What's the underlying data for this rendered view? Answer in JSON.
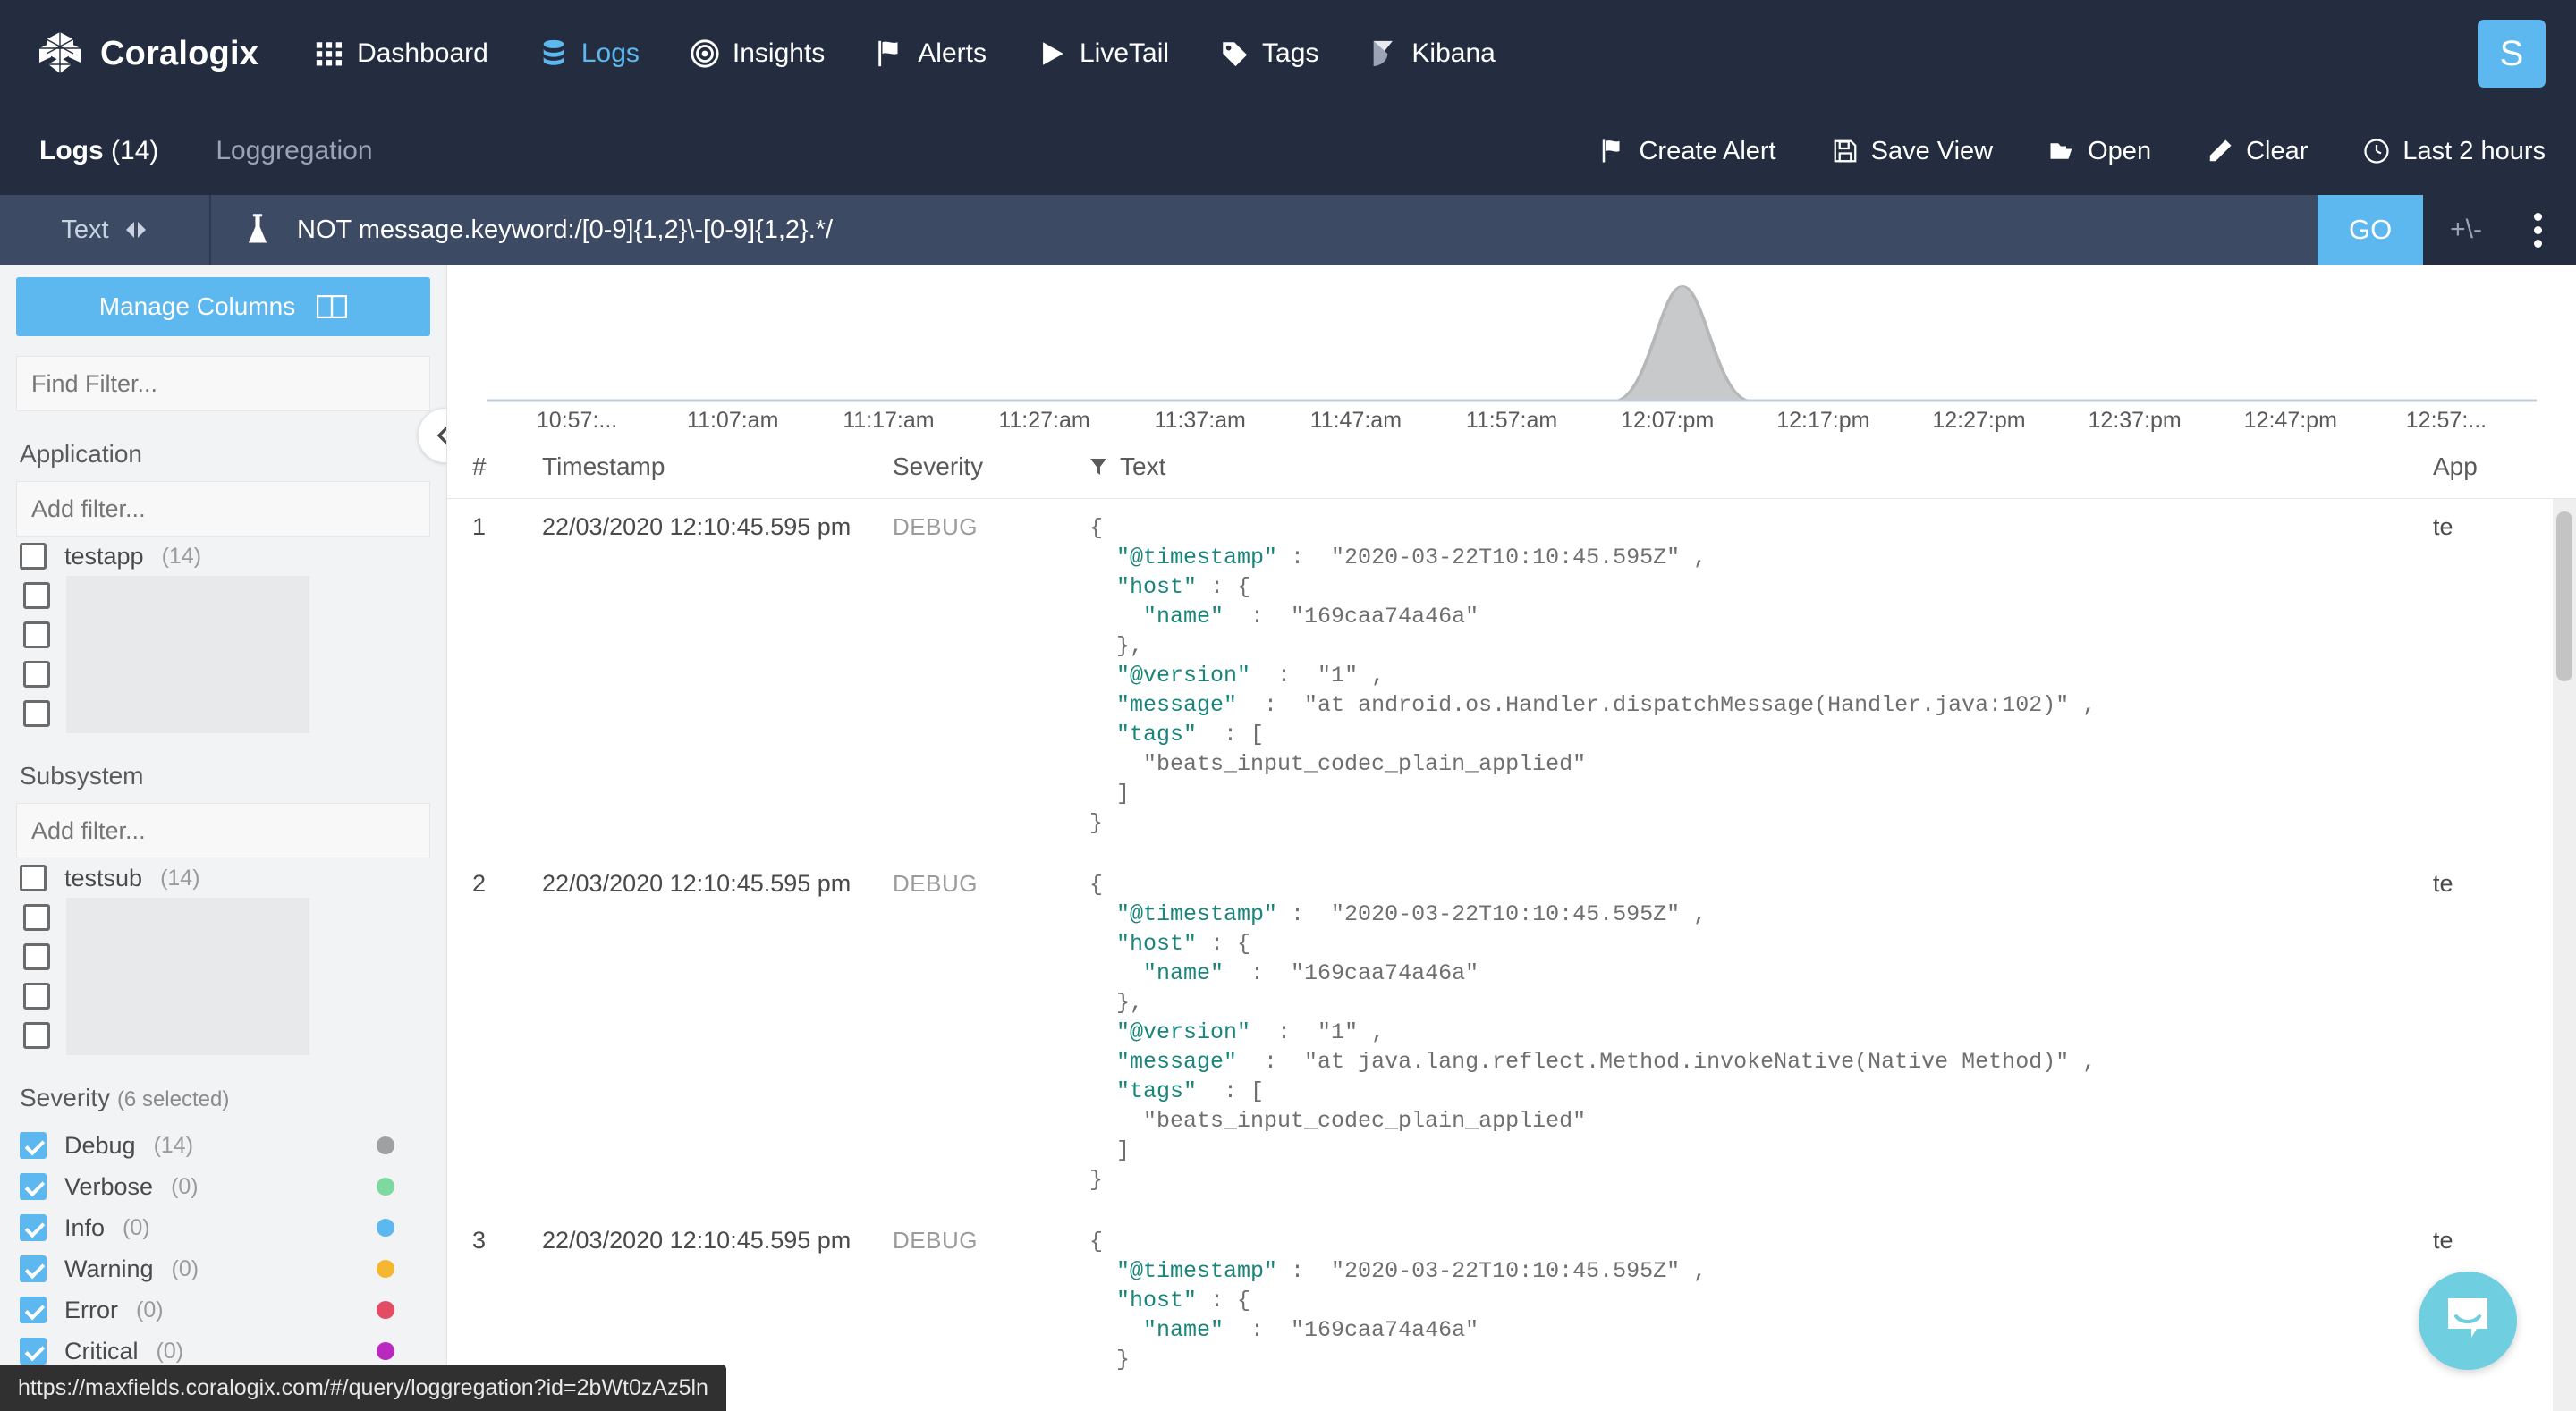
{
  "brand": {
    "name": "Coralogix"
  },
  "topnav": {
    "items": [
      {
        "label": "Dashboard",
        "icon": "grid-icon",
        "active": false
      },
      {
        "label": "Logs",
        "icon": "database-icon",
        "active": true
      },
      {
        "label": "Insights",
        "icon": "target-icon",
        "active": false
      },
      {
        "label": "Alerts",
        "icon": "flag-icon",
        "active": false
      },
      {
        "label": "LiveTail",
        "icon": "play-icon",
        "active": false
      },
      {
        "label": "Tags",
        "icon": "tag-icon",
        "active": false
      },
      {
        "label": "Kibana",
        "icon": "kibana-icon",
        "active": false
      }
    ],
    "avatar_initial": "S"
  },
  "subnav": {
    "tabs": [
      {
        "label": "Logs",
        "count": "(14)",
        "active": true
      },
      {
        "label": "Loggregation",
        "count": "",
        "active": false
      }
    ],
    "actions": [
      {
        "label": "Create Alert",
        "icon": "flag-icon"
      },
      {
        "label": "Save View",
        "icon": "floppy-icon"
      },
      {
        "label": "Open",
        "icon": "folder-open-icon"
      },
      {
        "label": "Clear",
        "icon": "eraser-icon"
      },
      {
        "label": "Last 2 hours",
        "icon": "clock-icon"
      }
    ]
  },
  "querybar": {
    "mode_label": "Text",
    "query": "NOT message.keyword:/[0-9]{1,2}\\-[0-9]{1,2}.*/",
    "go_label": "GO",
    "plus_minus_label": "+\\-"
  },
  "sidebar": {
    "manage_columns_label": "Manage Columns",
    "find_filter_placeholder": "Find Filter...",
    "application": {
      "title": "Application",
      "add_filter_placeholder": "Add filter...",
      "items": [
        {
          "label": "testapp",
          "count": "(14)",
          "checked": false
        }
      ]
    },
    "subsystem": {
      "title": "Subsystem",
      "add_filter_placeholder": "Add filter...",
      "items": [
        {
          "label": "testsub",
          "count": "(14)",
          "checked": false
        }
      ]
    },
    "severity": {
      "title": "Severity",
      "subtitle": "(6 selected)",
      "items": [
        {
          "label": "Debug",
          "count": "(14)",
          "checked": true,
          "color": "#a0a0a0"
        },
        {
          "label": "Verbose",
          "count": "(0)",
          "checked": true,
          "color": "#7ed99f"
        },
        {
          "label": "Info",
          "count": "(0)",
          "checked": true,
          "color": "#5cb8ef"
        },
        {
          "label": "Warning",
          "count": "(0)",
          "checked": true,
          "color": "#f5b731"
        },
        {
          "label": "Error",
          "count": "(0)",
          "checked": true,
          "color": "#e44c63"
        },
        {
          "label": "Critical",
          "count": "(0)",
          "checked": true,
          "color": "#bb28c0"
        }
      ]
    }
  },
  "chart_data": {
    "type": "area",
    "title": "",
    "xlabel": "",
    "ylabel": "",
    "grid": false,
    "legend": "none",
    "series_color": "#c8c9ca",
    "x": [
      "10:57:...",
      "11:07:am",
      "11:17:am",
      "11:27:am",
      "11:37:am",
      "11:47:am",
      "11:57:am",
      "12:07:pm",
      "12:17:pm",
      "12:27:pm",
      "12:37:pm",
      "12:47:pm",
      "12:57:..."
    ],
    "categories": [
      "10:57:...",
      "11:07:am",
      "11:17:am",
      "11:27:am",
      "11:37:am",
      "11:47:am",
      "11:57:am",
      "12:07:pm",
      "12:17:pm",
      "12:27:pm",
      "12:37:pm",
      "12:47:pm",
      "12:57:..."
    ],
    "values": [
      0,
      0,
      0,
      0,
      0,
      0,
      0,
      14,
      0,
      0,
      0,
      0,
      0
    ],
    "ylim": [
      0,
      14
    ],
    "peak_label": "12:07:pm",
    "peak_value": 14
  },
  "table": {
    "columns": [
      "#",
      "Timestamp",
      "Severity",
      "Text",
      "App"
    ],
    "rows": [
      {
        "num": "1",
        "timestamp": "22/03/2020 12:10:45.595 pm",
        "severity": "DEBUG",
        "app": "te",
        "json_lines": [
          {
            "indent": 0,
            "key": "",
            "text": "{"
          },
          {
            "indent": 1,
            "key": "\"@timestamp\"",
            "text": " :  \"2020-03-22T10:10:45.595Z\" ,"
          },
          {
            "indent": 1,
            "key": "\"host\"",
            "text": " : {"
          },
          {
            "indent": 2,
            "key": "\"name\"",
            "text": "  :  \"169caa74a46a\""
          },
          {
            "indent": 1,
            "key": "",
            "text": "},"
          },
          {
            "indent": 1,
            "key": "\"@version\"",
            "text": "  :  \"1\" ,"
          },
          {
            "indent": 1,
            "key": "\"message\"",
            "text": "  :  \"at android.os.Handler.dispatchMessage(Handler.java:102)\" ,"
          },
          {
            "indent": 1,
            "key": "\"tags\"",
            "text": "  : ["
          },
          {
            "indent": 2,
            "key": "",
            "text": "\"beats_input_codec_plain_applied\""
          },
          {
            "indent": 1,
            "key": "",
            "text": "]"
          },
          {
            "indent": 0,
            "key": "",
            "text": "}"
          }
        ]
      },
      {
        "num": "2",
        "timestamp": "22/03/2020 12:10:45.595 pm",
        "severity": "DEBUG",
        "app": "te",
        "json_lines": [
          {
            "indent": 0,
            "key": "",
            "text": "{"
          },
          {
            "indent": 1,
            "key": "\"@timestamp\"",
            "text": " :  \"2020-03-22T10:10:45.595Z\" ,"
          },
          {
            "indent": 1,
            "key": "\"host\"",
            "text": " : {"
          },
          {
            "indent": 2,
            "key": "\"name\"",
            "text": "  :  \"169caa74a46a\""
          },
          {
            "indent": 1,
            "key": "",
            "text": "},"
          },
          {
            "indent": 1,
            "key": "\"@version\"",
            "text": "  :  \"1\" ,"
          },
          {
            "indent": 1,
            "key": "\"message\"",
            "text": "  :  \"at java.lang.reflect.Method.invokeNative(Native Method)\" ,"
          },
          {
            "indent": 1,
            "key": "\"tags\"",
            "text": "  : ["
          },
          {
            "indent": 2,
            "key": "",
            "text": "\"beats_input_codec_plain_applied\""
          },
          {
            "indent": 1,
            "key": "",
            "text": "]"
          },
          {
            "indent": 0,
            "key": "",
            "text": "}"
          }
        ]
      },
      {
        "num": "3",
        "timestamp": "22/03/2020 12:10:45.595 pm",
        "severity": "DEBUG",
        "app": "te",
        "json_lines": [
          {
            "indent": 0,
            "key": "",
            "text": "{"
          },
          {
            "indent": 1,
            "key": "\"@timestamp\"",
            "text": " :  \"2020-03-22T10:10:45.595Z\" ,"
          },
          {
            "indent": 1,
            "key": "\"host\"",
            "text": " : {"
          },
          {
            "indent": 2,
            "key": "\"name\"",
            "text": "  :  \"169caa74a46a\""
          },
          {
            "indent": 1,
            "key": "",
            "text": "}"
          }
        ]
      }
    ]
  },
  "statusbar": {
    "url": "https://maxfields.coralogix.com/#/query/loggregation?id=2bWt0zAz5ln"
  }
}
